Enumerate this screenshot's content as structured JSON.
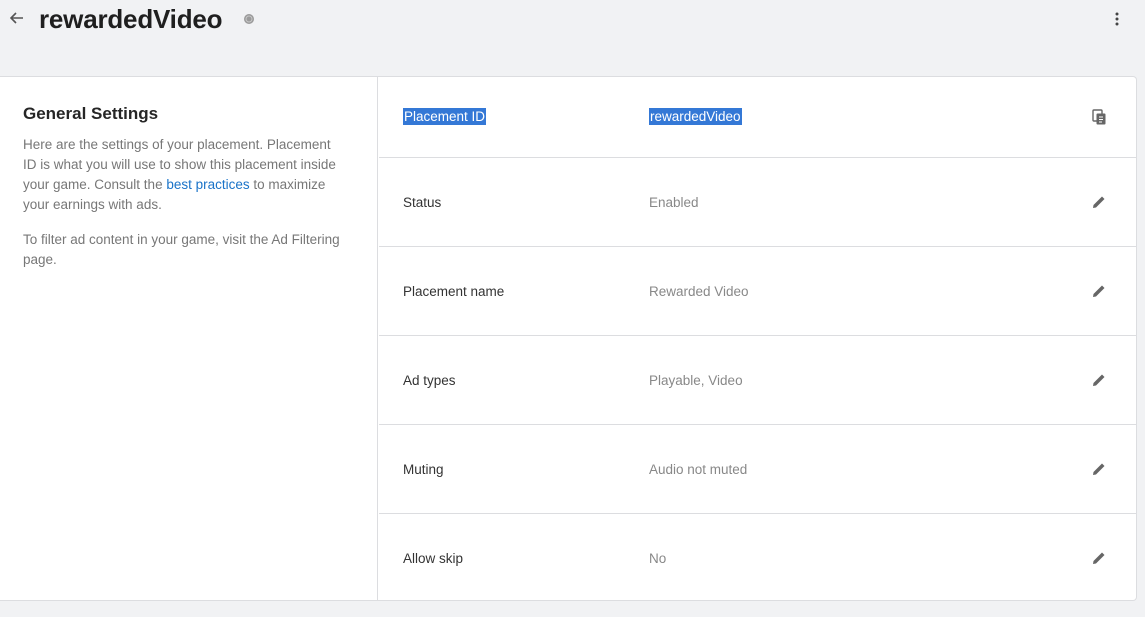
{
  "header": {
    "title": "rewardedVideo",
    "back_icon": "arrow-left-icon",
    "status_icon": "status-dot-icon",
    "more_icon": "more-vertical-icon"
  },
  "general": {
    "title": "General Settings",
    "desc_part1": "Here are the settings of your placement. Placement ID is what you will use to show this placement inside your game. Consult the ",
    "desc_link": "best practices",
    "desc_part2": " to maximize your earnings with ads.",
    "desc_second": "To filter ad content in your game, visit the Ad Filtering page."
  },
  "rows": [
    {
      "label": "Placement ID",
      "value": "rewardedVideo",
      "action_icon": "copy-icon",
      "selected": true
    },
    {
      "label": "Status",
      "value": "Enabled",
      "action_icon": "pencil-icon",
      "selected": false
    },
    {
      "label": "Placement name",
      "value": "Rewarded Video",
      "action_icon": "pencil-icon",
      "selected": false
    },
    {
      "label": "Ad types",
      "value": "Playable, Video",
      "action_icon": "pencil-icon",
      "selected": false
    },
    {
      "label": "Muting",
      "value": "Audio not muted",
      "action_icon": "pencil-icon",
      "selected": false
    },
    {
      "label": "Allow skip",
      "value": "No",
      "action_icon": "pencil-icon",
      "selected": false
    }
  ],
  "colors": {
    "selection": "#3478d6",
    "link": "#1a73c8",
    "background": "#f1f2f4"
  }
}
